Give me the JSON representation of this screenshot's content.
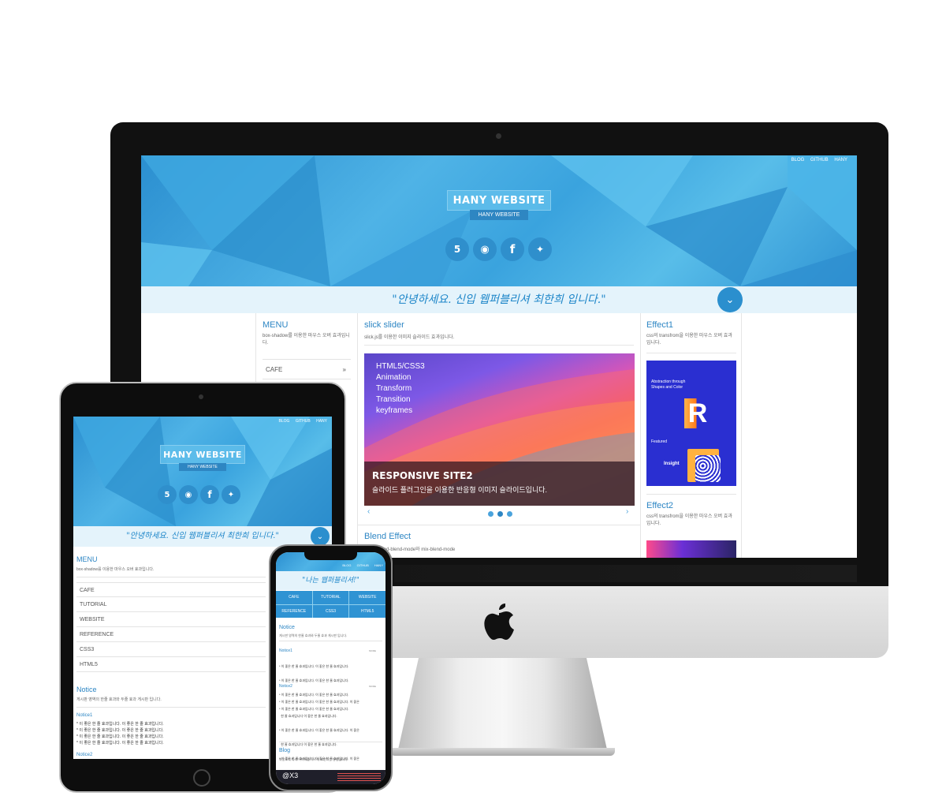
{
  "site": {
    "nav": [
      "BLOG",
      "GITHUB",
      "HANY"
    ],
    "title": "HANY WEBSITE",
    "subtitle": "HANY WEBSITE",
    "greeting": "\"안녕하세요. 신입 웹퍼블리셔 최한희 입니다.\"",
    "social_icons": [
      "html5-icon",
      "github-icon",
      "facebook-icon",
      "twitter-icon"
    ]
  },
  "desktop": {
    "menu": {
      "title": "MENU",
      "desc": "box-shadow를 이용한 마우스 오버 효과입니다.",
      "items": [
        "CAFE"
      ]
    },
    "slider": {
      "title": "slick slider",
      "desc": "slick.js를 이용한 이미지 슬라이드 효과입니다.",
      "lines": [
        "HTML5/CSS3",
        "Animation",
        "Transform",
        "Transition",
        "keyframes"
      ],
      "caption_title": "RESPONSIVE SITE2",
      "caption_text": "슬라이드 플러그인을 이용한 반응형 이미지 슬라이드입니다.",
      "prev": "‹",
      "next": "›"
    },
    "blend": {
      "title": "Blend Effect",
      "desc": "background-blend-mode와 mix-blend-mode"
    },
    "effect1": {
      "title": "Effect1",
      "desc": "css의 transfrom을 이용한 마우스 오버 효과 입니다.",
      "thumb_text": "Abstraction through Shapes and Color",
      "thumb_letter": "R",
      "thumb_label1": "Featured",
      "thumb_label2": "Insight"
    },
    "effect2": {
      "title": "Effect2",
      "desc": "css의 transfrom을 이용한 마우스 오버 효과 입니다."
    }
  },
  "tablet": {
    "menu": {
      "title": "MENU",
      "desc": "box-shadow를 이용한 마우스 오버 효과입니다.",
      "items": [
        "CAFE",
        "TUTORIAL",
        "WEBSITE",
        "REFERENCE",
        "CSS3",
        "HTML5"
      ]
    },
    "notice": {
      "title": "Notice",
      "desc": "게시판 영역의 한줄 효과와 두줄 효과 게시판 입니다.",
      "item_title": "Notice1",
      "lines": [
        "* 이 좋은 한 줄 효과입니다. 이 좋은 한 줄 효과입니다.",
        "* 이 좋은 한 줄 효과입니다. 이 좋은 한 줄 효과입니다.",
        "* 이 좋은 한 줄 효과입니다. 이 좋은 한 줄 효과입니다.",
        "* 이 좋은 한 줄 효과입니다. 이 좋은 한 줄 효과입니다."
      ],
      "next_title": "Notice2"
    }
  },
  "phone": {
    "nav": [
      "BLOG",
      "GITHUB",
      "HANY"
    ],
    "greeting": "\"나는 웹퍼블리셔!\"",
    "grid": [
      "CAFE",
      "TUTORIAL",
      "WEBSITE",
      "REFERENCE",
      "CSS3",
      "HTML5"
    ],
    "notice": {
      "title": "Notice",
      "desc": "게시판 영역의 한줄 효과와 두줄 효과 게시판 입니다.",
      "n1": "Notice1",
      "n2": "Notice2",
      "more": "MORE",
      "lines1": [
        "* 이 좋은 한 줄 효과입니다. 이 좋은 한 줄 효과입니다.",
        "* 이 좋은 한 줄 효과입니다. 이 좋은 한 줄 효과입니다.",
        "* 이 좋은 한 줄 효과입니다. 이 좋은 한 줄 효과입니다.",
        "* 이 좋은 한 줄 효과입니다. 이 좋은 한 줄 효과입니다."
      ],
      "lines2": [
        "* 이 좋은 한 줄 효과입니다. 이 좋은 한 줄 효과입니다. 이 좋은",
        "  한 줄 효과입니다 이 좋은 한 줄 효과입니다.",
        "* 이 좋은 한 줄 효과입니다. 이 좋은 한 줄 효과입니다. 이 좋은",
        "  한 줄 효과입니다 이 좋은 한 줄 효과입니다.",
        "* 이 좋은 한 줄 효과입니다. 이 좋은 한 줄 효과입니다. 이 좋은",
        "  한 줄 효과입니다 이 좋은 한 줄 효과입니다."
      ]
    },
    "blog": {
      "title": "Blog",
      "desc": "화상도에 따라 이미지를 다르게 표현하는 방법입니다."
    },
    "badge": "@X3"
  },
  "colors": {
    "accent": "#2d86c4",
    "hero": "#4fb3e6",
    "greeting_bg": "#e4f3fb"
  }
}
